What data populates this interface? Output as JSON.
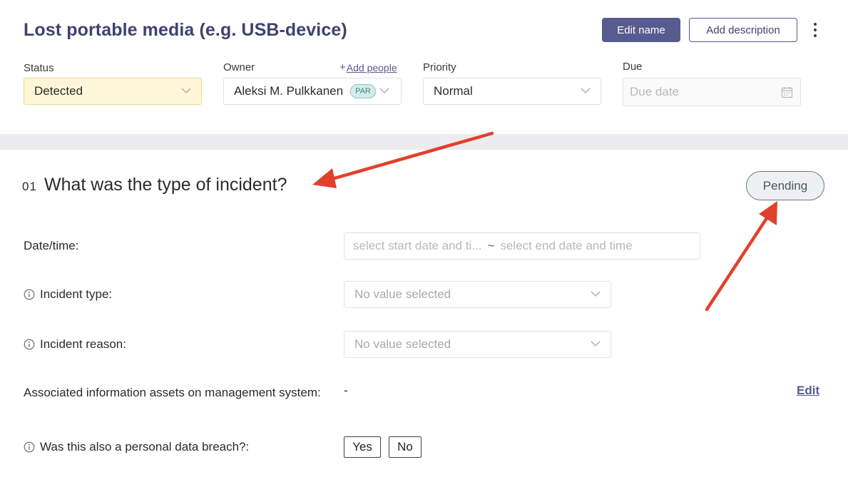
{
  "header": {
    "title": "Lost portable media (e.g. USB-device)",
    "edit_name_label": "Edit name",
    "add_description_label": "Add description"
  },
  "fields": {
    "status": {
      "label": "Status",
      "value": "Detected"
    },
    "owner": {
      "label": "Owner",
      "value": "Aleksi M. Pulkkanen",
      "badge": "PAR",
      "add_people_label": "Add people"
    },
    "priority": {
      "label": "Priority",
      "value": "Normal"
    },
    "due": {
      "label": "Due",
      "placeholder": "Due date"
    }
  },
  "section": {
    "number": "01",
    "title": "What was the type of incident?",
    "status_label": "Pending",
    "rows": {
      "datetime": {
        "label": "Date/time:",
        "start_placeholder": "select start date and ti...",
        "separator": "~",
        "end_placeholder": "select end date and time"
      },
      "incident_type": {
        "label": "Incident type:",
        "value": "No value selected"
      },
      "incident_reason": {
        "label": "Incident reason:",
        "value": "No value selected"
      },
      "assets": {
        "label": "Associated information assets on management system:",
        "value": "-",
        "edit_label": "Edit"
      },
      "personal_breach": {
        "label": "Was this also a personal data breach?:",
        "yes_label": "Yes",
        "no_label": "No"
      }
    }
  },
  "colors": {
    "primary": "#575b8f",
    "title": "#3f4270",
    "status_bg": "#fdf7d8",
    "annotation_arrow": "#e2402b"
  }
}
